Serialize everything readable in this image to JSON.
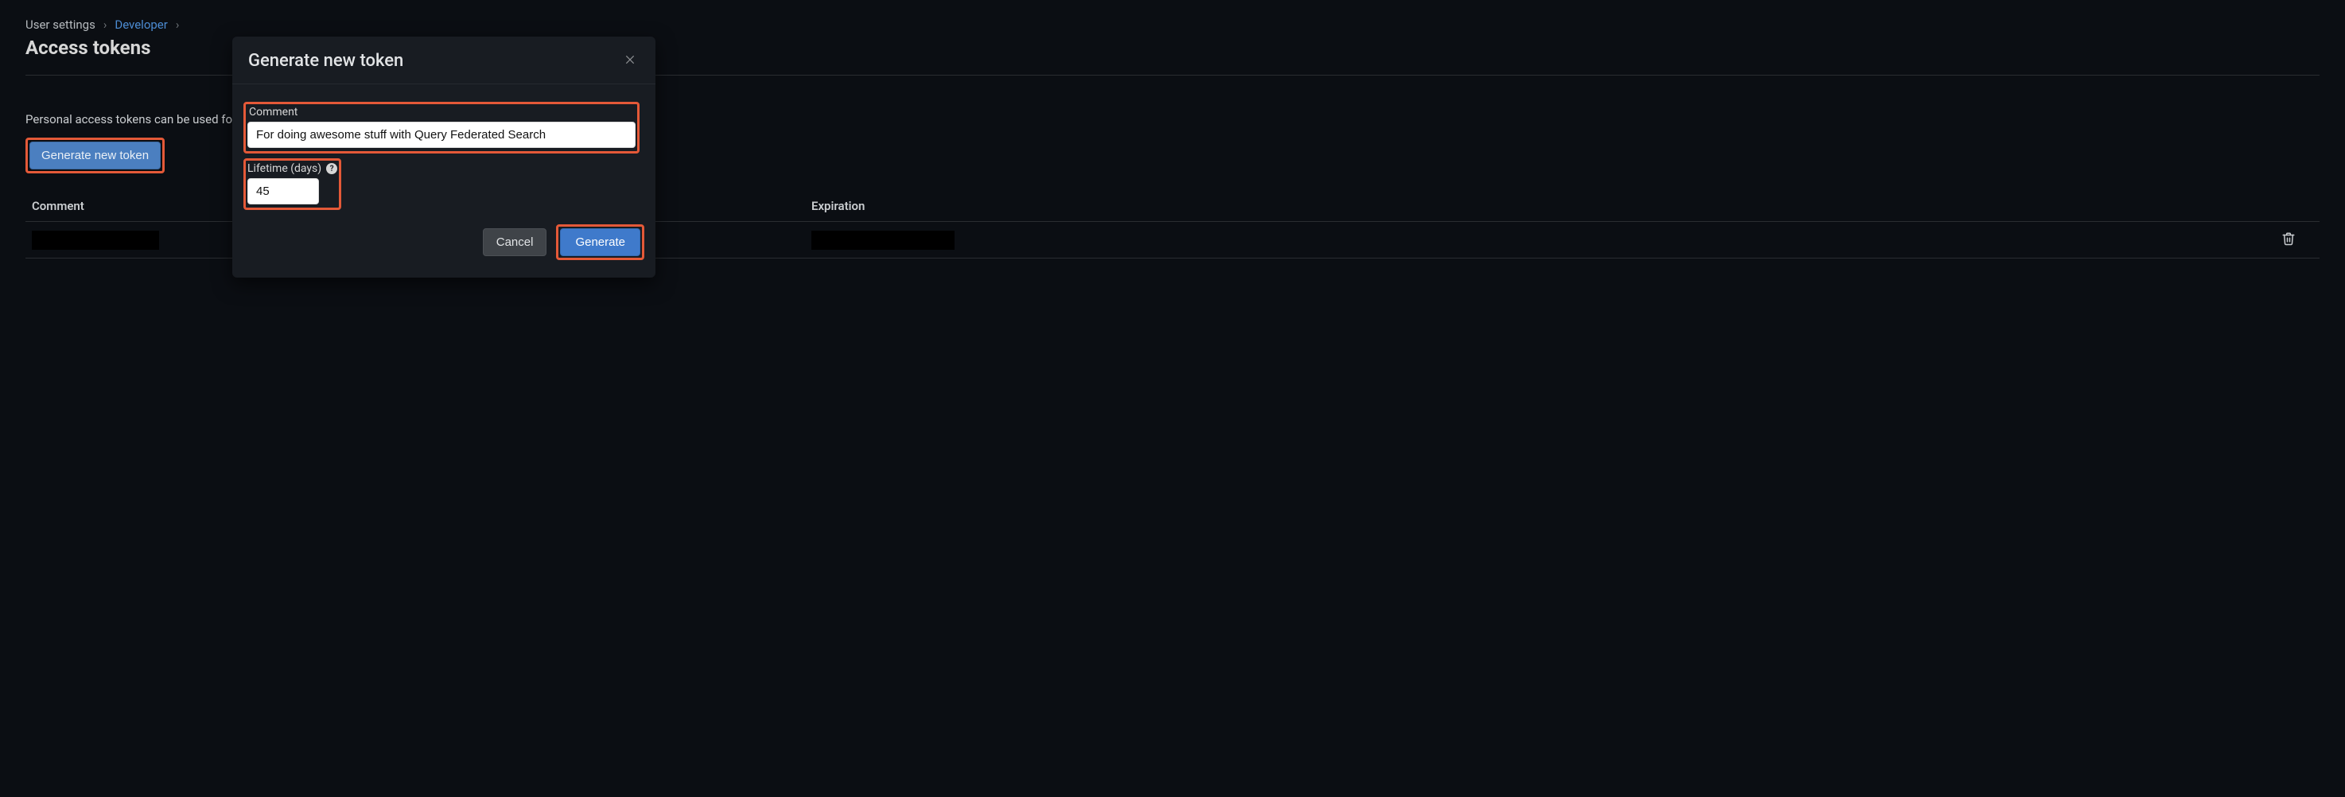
{
  "breadcrumb": {
    "item1": "User settings",
    "item2": "Developer",
    "sep": "›"
  },
  "page_title": "Access tokens",
  "description_visible": "Personal access tokens can be used for",
  "generate_button_label": "Generate new token",
  "table": {
    "col_comment": "Comment",
    "col_expiration": "Expiration"
  },
  "modal": {
    "title": "Generate new token",
    "comment_label": "Comment",
    "comment_value": "For doing awesome stuff with Query Federated Search",
    "lifetime_label": "Lifetime (days)",
    "lifetime_value": "45",
    "help_glyph": "?",
    "cancel_label": "Cancel",
    "generate_label": "Generate"
  },
  "icons": {
    "trash": "trash-icon",
    "close": "close-icon"
  },
  "colors": {
    "accent": "#3f7acb",
    "highlight": "#e45938",
    "bg": "#0b0e13",
    "modal_bg": "#181c22"
  }
}
